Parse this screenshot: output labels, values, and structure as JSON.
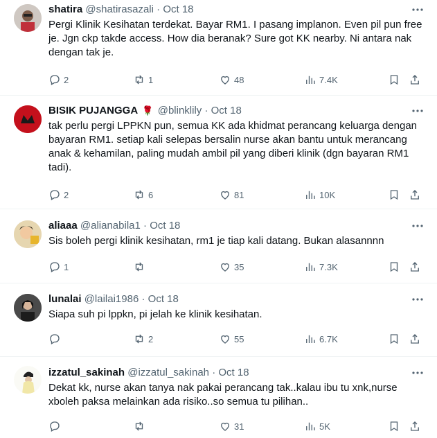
{
  "tweets": [
    {
      "name": "shatira",
      "handle": "@shatirasazali",
      "dot": "·",
      "date": "Oct 18",
      "text": "Pergi Klinik Kesihatan terdekat. Bayar RM1. I pasang implanon. Even pil pun free je. Jgn ckp takde access. How dia beranak? Sure got KK nearby. Ni antara nak dengan tak je.",
      "replies": "2",
      "reposts": "1",
      "likes": "48",
      "views": "7.4K"
    },
    {
      "name": "BISIK PUJANGGA",
      "emoji": "🌹",
      "handle": "@blinklily",
      "dot": "·",
      "date": "Oct 18",
      "text": "tak perlu pergi LPPKN pun, semua KK ada khidmat perancang keluarga dengan bayaran RM1. setiap kali selepas bersalin nurse akan bantu untuk merancang anak & kehamilan, paling mudah ambil pil yang diberi klinik (dgn bayaran RM1 tadi).",
      "replies": "2",
      "reposts": "6",
      "likes": "81",
      "views": "10K"
    },
    {
      "name": "aliaaa",
      "handle": "@alianabila1",
      "dot": "·",
      "date": "Oct 18",
      "text": "Sis boleh pergi klinik kesihatan, rm1 je tiap kali datang. Bukan alasannnn",
      "replies": "1",
      "reposts": "",
      "likes": "35",
      "views": "7.3K"
    },
    {
      "name": "lunalai",
      "handle": "@lailai1986",
      "dot": "·",
      "date": "Oct 18",
      "text": "Siapa suh pi lppkn, pi jelah ke klinik kesihatan.",
      "replies": "",
      "reposts": "2",
      "likes": "55",
      "views": "6.7K"
    },
    {
      "name": "izzatul_sakinah",
      "handle": "@izzatul_sakinah",
      "dot": "·",
      "date": "Oct 18",
      "text": "Dekat kk, nurse akan tanya nak pakai perancang tak..kalau ibu tu xnk,nurse xboleh paksa melainkan ada risiko..so semua tu pilihan..",
      "replies": "",
      "reposts": "",
      "likes": "31",
      "views": "5K"
    }
  ],
  "colors": {
    "text": "#0f1419",
    "muted": "#536471",
    "divider": "#eff3f4"
  },
  "icons": [
    "more-icon",
    "reply-icon",
    "repost-icon",
    "like-icon",
    "views-icon",
    "bookmark-icon",
    "share-icon"
  ]
}
